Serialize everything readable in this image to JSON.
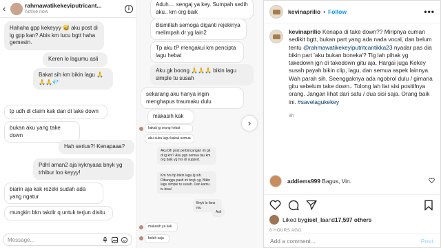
{
  "dm_left": {
    "name": "rahmawatikekeyiputricant...",
    "status": "Active now",
    "messages": [
      "Hahaha gpp kekeyyy 😅 aku post di ig gpp kan? Abis km lucu bgtt haha gemesin.",
      "Keren lo lagumu asli",
      "Bakat sih km bikin lagu 🙏🙏🙏💎",
      "tp udh di claim kak dan di take down",
      "bukan aku yang take down",
      "Hah serius?! Kenapaaa?",
      "Pdhl aman2 aja kyknyaaa bnyk yg trhibur loo keyyy!",
      "biarin aja kak rezeki sudah ada yang ngatur",
      "mungkin bkn takdir q untuk terjun disitu"
    ],
    "input_placeholder": "Message..."
  },
  "dm_right": {
    "messages": [
      "Aduh.... sengaj ya key. Sumpah sedih aku.. km org baik",
      "Bismillah semoga diganti rejekinya melimpah dr yg lain2",
      "Tp aku tP mengakui km pencipta lagu hebat",
      "Aku gk boong 🙏🙏🙏 bikin lagu simple tu susah",
      "sekarang aku hanya ingin menghapus traumaku dulu",
      "makasih kak",
      "kakak jg orang hebat",
      "aku suka lagu kakak semua",
      "Aku blh post perbincangan ini gk di ig km? Aku pgn semua tau km org baik yg hrs di support.",
      "Km hrs ttp bikin lagu lg sih. Dibunggu pasti ini bnyk yg. Bikin lagu simple tu susah. Dan kamu tu bisa!",
      "Bnyk lo fans mu",
      "Asli",
      "makasih ya kak",
      "boleh saja"
    ]
  },
  "header": {
    "username": "kevinaprilio",
    "dot": "•",
    "follow_label": "Follow",
    "more_label": "•••"
  },
  "caption": {
    "username": "kevinaprilio",
    "text_before": " Kenapa di take down?? Miripnya cuman sedikit bgtt, bukan part yang ada nada vocal, dan belum tentu ",
    "mention": "@rahmawatikekeyiputritcantikka23",
    "text_after": " nyadar pas dia bikin part 'aku bukan boneka'? Tlg lah pihak yg takedown jgn di takedown gitu aja. Hargai juga Kekey susah payah bikin clip, lagu, dan semua aspek lainnya. Wah parah sih. Seenggaknya ada ngobrol dulu / gimana gitu sebelum take down.. Tolong lah liat sisi positifnya orang. Jangan lihat dari satu / dua sisi saja. Orang baik ini. ",
    "hashtag": "#savelagukekey",
    "time": "8h"
  },
  "reply": {
    "username": "addiems999",
    "text": " Bagus, Vin."
  },
  "likes": {
    "prefix": "Liked by ",
    "user": "gisel_la",
    "middle": " and ",
    "others": "17,597 others"
  },
  "post_time": "8 HOURS AGO",
  "comment_bar": {
    "placeholder": "Add a comment...",
    "post_label": "Post"
  },
  "colors": {
    "accent": "#0095f6",
    "mention": "#00376b",
    "muted": "#8e8e8e"
  }
}
